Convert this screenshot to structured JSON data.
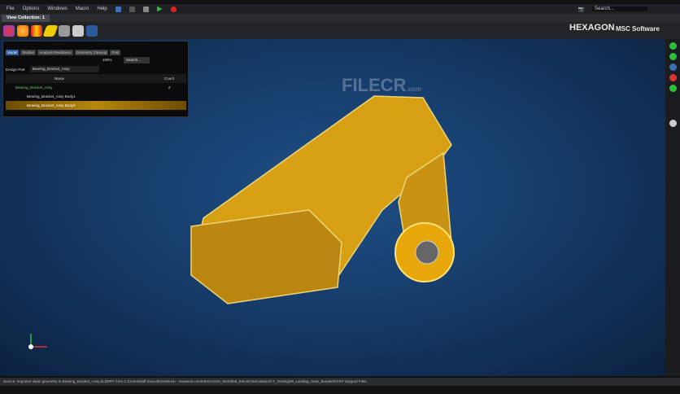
{
  "menu": [
    "File",
    "Options",
    "Windows",
    "Macro",
    "Help"
  ],
  "search_placeholder": "Search...",
  "tab": "View Collection: 1",
  "brand": {
    "hexagon": "HEXAGON",
    "msc": "MSC Software"
  },
  "panel": {
    "tabs": [
      "Model",
      "Studies",
      "Analysis Readiness",
      "Geometry Cleanup",
      "Post"
    ],
    "zoom": "100%",
    "search": "Search...",
    "design_part_label": "Design Part",
    "design_part": "Bearing_Bracket_Assy",
    "columns": [
      "Name",
      "Count"
    ],
    "rows": [
      {
        "name": "Bearing_Bracket_Assy",
        "count": "2"
      },
      {
        "name": "Bearing_Bracket_Assy Body1",
        "count": ""
      },
      {
        "name": "Bearing_Bracket_Assy Body2",
        "count": ""
      }
    ]
  },
  "watermark": "FILECR",
  "watermark_sub": ".com",
  "status": "Source: Imported clean geometry to Bearing_Bracket_Assy.SLDPRT from C:\\Users\\staff.mwood\\OneDrive - msowest.com\\HEXAGON_World\\06_Electric\\Simulation\\CT_Testing\\09_Landing_Gear_Bracket\\STEP Support Files",
  "colors": {
    "accent": "#2c5b9b",
    "part": "#e8a80c",
    "selected": "#b8860b"
  }
}
